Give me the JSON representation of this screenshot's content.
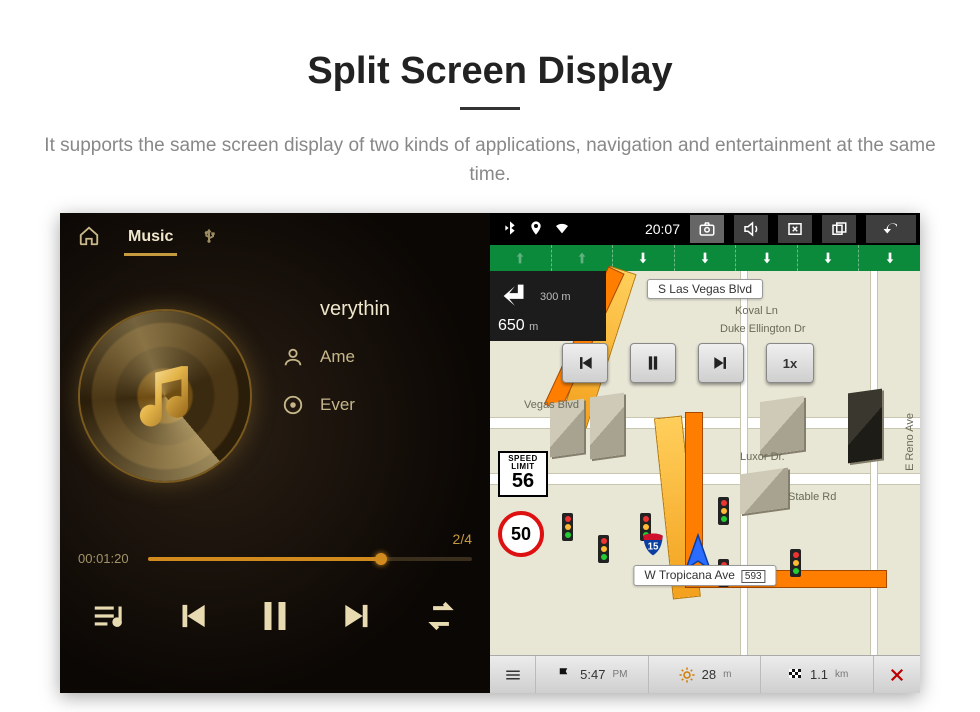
{
  "page": {
    "title": "Split Screen Display",
    "description": "It supports the same screen display of two kinds of applications, navigation and entertainment at the same time."
  },
  "music": {
    "tab_music": "Music",
    "tab_usb_icon": "usb",
    "now_playing_truncated": "verythin",
    "artist_truncated": "Ame",
    "album_truncated": "Ever",
    "track_counter": "2/4",
    "elapsed": "00:01:20",
    "progress_pct": 72
  },
  "nav": {
    "status": {
      "clock": "20:07"
    },
    "lanes": [
      "up",
      "up",
      "down",
      "down",
      "down",
      "down",
      "down"
    ],
    "turn": {
      "next_dist": "300",
      "next_unit": "m",
      "total_dist": "650",
      "total_unit": "m"
    },
    "speed_limit": {
      "label1": "SPEED",
      "label2": "LIMIT",
      "value": "56"
    },
    "current_speed": "50",
    "street_top": "S Las Vegas Blvd",
    "street_bottom": "W Tropicana Ave",
    "street_bottom_shield": "593",
    "hwy_shield": "15",
    "labels": {
      "koval": "Koval Ln",
      "duke": "Duke Ellington Dr",
      "vegas_blvd": "Vegas Blvd",
      "luxor": "Luxor Dr.",
      "stable": "Stable Rd",
      "reno": "E Reno Ave"
    },
    "overlay_speed": "1x",
    "bottom": {
      "eta": "5:47",
      "eta_unit": "PM",
      "trip_time": "28",
      "trip_unit": "m",
      "trip_dist": "1.1",
      "dist_unit": "km"
    }
  }
}
